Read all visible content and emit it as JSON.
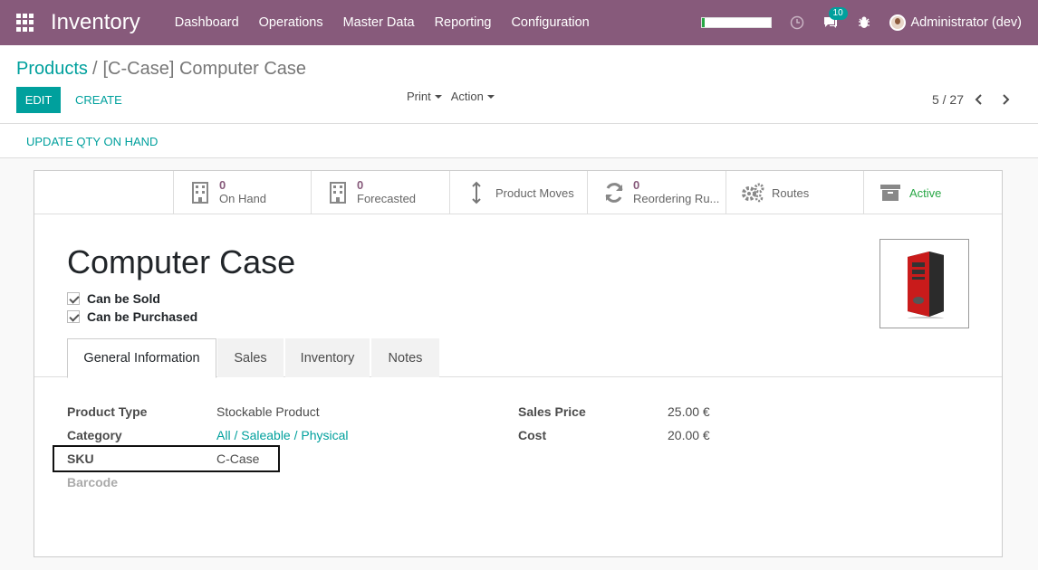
{
  "navbar": {
    "app_name": "Inventory",
    "menu": [
      "Dashboard",
      "Operations",
      "Master Data",
      "Reporting",
      "Configuration"
    ],
    "progress": 0.05,
    "messages_count": "10",
    "user": "Administrator (dev)",
    "bg_color": "#875a7b"
  },
  "breadcrumb": {
    "parent": "Products",
    "separator": "/",
    "current": "[C-Case] Computer Case"
  },
  "buttons": {
    "edit": "EDIT",
    "create": "CREATE",
    "print": "Print",
    "action": "Action",
    "update_qty": "UPDATE QTY ON HAND"
  },
  "pager": {
    "value": "5 / 27"
  },
  "smart_buttons": {
    "on_hand": {
      "value": "0",
      "label": "On Hand"
    },
    "forecasted": {
      "value": "0",
      "label": "Forecasted"
    },
    "moves": {
      "label": "Product Moves"
    },
    "reordering": {
      "value": "0",
      "label": "Reordering Ru..."
    },
    "routes": {
      "label": "Routes"
    },
    "active": {
      "label": "Active"
    }
  },
  "product": {
    "name": "Computer Case",
    "can_be_sold": "Can be Sold",
    "can_be_purchased": "Can be Purchased"
  },
  "tabs": [
    "General Information",
    "Sales",
    "Inventory",
    "Notes"
  ],
  "fields": {
    "product_type": {
      "label": "Product Type",
      "value": "Stockable Product"
    },
    "category": {
      "label": "Category",
      "value": "All / Saleable / Physical"
    },
    "sku": {
      "label": "SKU",
      "value": "C-Case"
    },
    "barcode": {
      "label": "Barcode"
    },
    "sales_price": {
      "label": "Sales Price",
      "value": "25.00 €"
    },
    "cost": {
      "label": "Cost",
      "value": "20.00 €"
    }
  },
  "colors": {
    "accent": "#00a09d",
    "brand": "#875a7b",
    "active": "#28a745"
  }
}
